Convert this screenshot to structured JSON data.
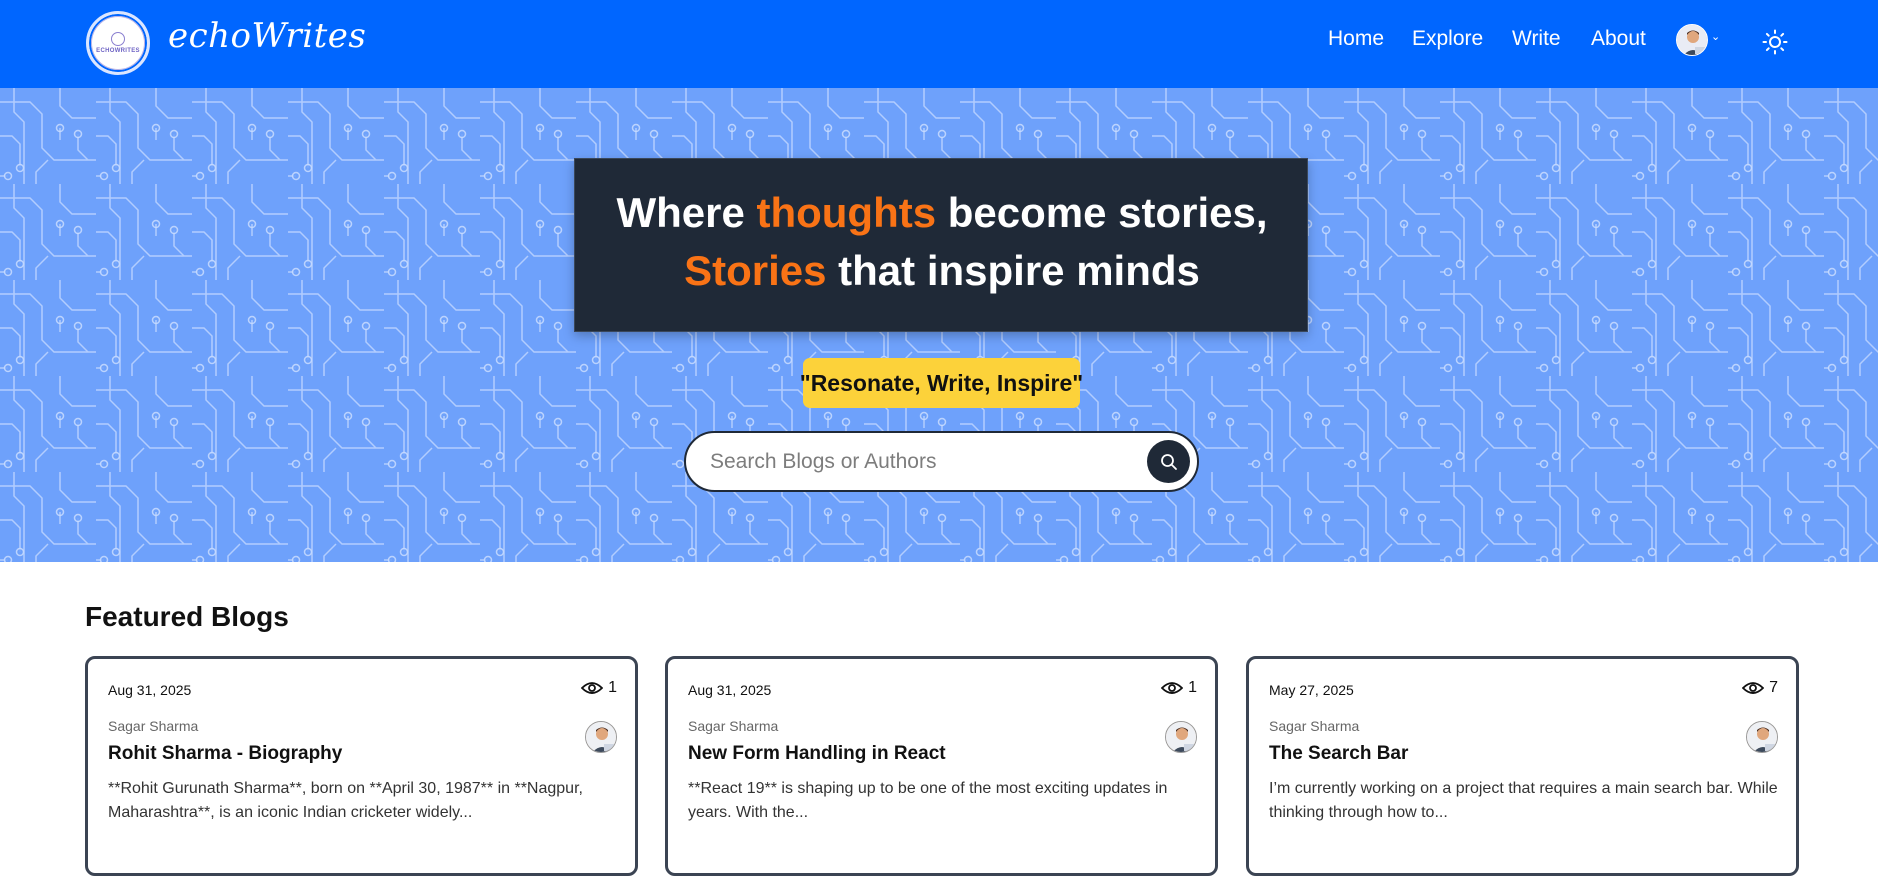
{
  "brand": {
    "logo_text": "ECHOWRITES",
    "name": "echoWrites"
  },
  "nav": {
    "items": [
      "Home",
      "Explore",
      "Write",
      "About"
    ],
    "avatar_icon": "user-avatar-icon",
    "theme_icon": "sun-icon"
  },
  "hero": {
    "headline_line1": [
      "Where ",
      "thoughts",
      " become stories,"
    ],
    "headline_line2": [
      "Stories",
      " that inspire minds"
    ],
    "tagline": "\"Resonate, Write, Inspire\"",
    "search_placeholder": "Search Blogs or Authors",
    "search_icon": "search-icon"
  },
  "colors": {
    "nav": "#0066ff",
    "hero_bg": "#6ea1fb",
    "headline_bg": "#1f2937",
    "accent": "#f97316",
    "tagline_bg": "#fcd23a"
  },
  "featured": {
    "title": "Featured Blogs",
    "cards": [
      {
        "date": "Aug 31, 2025",
        "views": "1",
        "author": "Sagar Sharma",
        "title": "Rohit Sharma - Biography",
        "excerpt": "**Rohit Gurunath Sharma**, born on **April 30, 1987** in **Nagpur, Maharashtra**, is an iconic Indian cricketer widely..."
      },
      {
        "date": "Aug 31, 2025",
        "views": "1",
        "author": "Sagar Sharma",
        "title": "New Form Handling in React",
        "excerpt": "**React 19** is shaping up to be one of the most exciting updates in years. With the..."
      },
      {
        "date": "May 27, 2025",
        "views": "7",
        "author": "Sagar Sharma",
        "title": "The Search Bar",
        "excerpt": "I’m currently working on a project that requires a main search bar. While thinking through how to..."
      }
    ]
  }
}
